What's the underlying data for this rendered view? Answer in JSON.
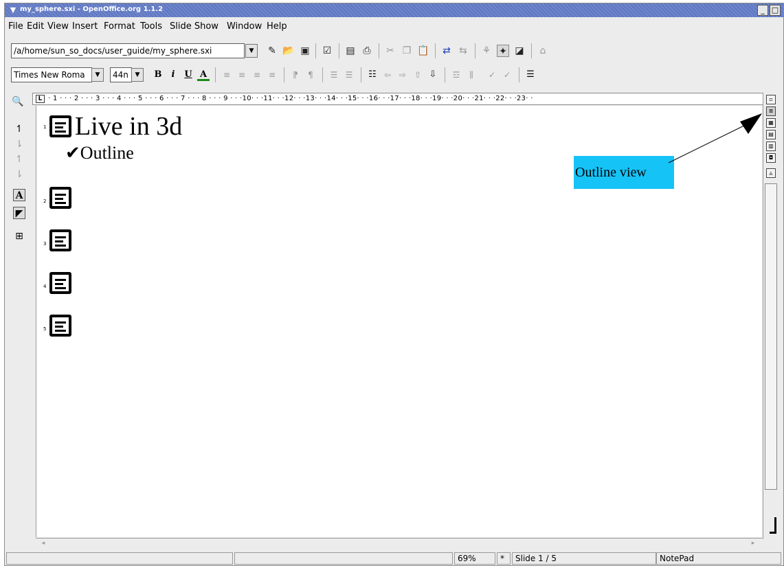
{
  "window": {
    "title": "my_sphere.sxi - OpenOffice.org 1.1.2"
  },
  "menu": [
    "File",
    "Edit",
    "View",
    "Insert",
    "Format",
    "Tools",
    "Slide Show",
    "Window",
    "Help"
  ],
  "toolbar": {
    "url": "/a/home/sun_so_docs/user_guide/my_sphere.sxi"
  },
  "format_toolbar": {
    "font_name": "Times New Roma",
    "font_size": "44n"
  },
  "ruler": {
    "ticks": "· 1 · · · 2 · · · 3 · · · 4 · · · 5 · · · 6 · · · 7 · · · 8 · · · 9 · · ·10· · ·11· · ·12· · ·13· · ·14· · ·15· · ·16· · ·17· · ·18· · ·19· · ·20· · ·21· · ·22· · ·23· ·"
  },
  "outline": {
    "slides": [
      {
        "number": "1",
        "title": "Live in 3d",
        "bullet": "Outline"
      },
      {
        "number": "2"
      },
      {
        "number": "3"
      },
      {
        "number": "4"
      },
      {
        "number": "5"
      }
    ]
  },
  "callout": {
    "text": "Outline view"
  },
  "status": {
    "zoom": "69%",
    "modified": "*",
    "slide": "Slide 1 / 5",
    "layout": "NotePad"
  }
}
